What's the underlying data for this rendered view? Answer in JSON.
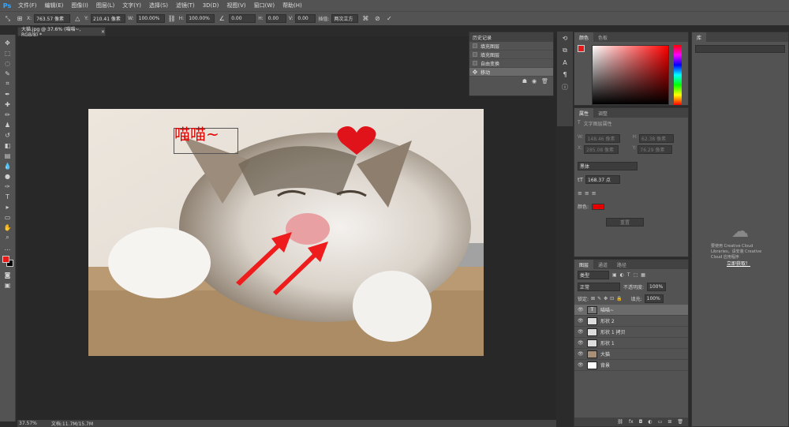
{
  "app": {
    "logo": "Ps"
  },
  "menu": [
    "文件(F)",
    "编辑(E)",
    "图像(I)",
    "图层(L)",
    "文字(Y)",
    "选择(S)",
    "滤镜(T)",
    "3D(D)",
    "视图(V)",
    "窗口(W)",
    "帮助(H)"
  ],
  "options": {
    "x_label": "X:",
    "x_value": "763.57 像素",
    "y_label": "Y:",
    "y_value": "210.41 像素",
    "w_label": "W:",
    "w_value": "100.00%",
    "h_label": "H:",
    "h_value": "100.00%",
    "angle_value": "0.00",
    "hskew_label": "H:",
    "hskew_value": "0.00",
    "vskew_label": "V:",
    "vskew_value": "0.00",
    "interp_label": "插值:",
    "interp_value": "两次立方"
  },
  "document": {
    "tab_title": "大猫.jpg @ 37.6% (喵喵~, RGB/8) *",
    "annotation_text": "喵喵~",
    "zoom": "37.57%",
    "doc_size": "文档:11.7M/15.7M"
  },
  "history": {
    "title": "历史记录",
    "items": [
      {
        "label": "填充图层",
        "selected": false
      },
      {
        "label": "填充图层",
        "selected": false
      },
      {
        "label": "自由变换",
        "selected": false
      },
      {
        "label": "移动",
        "selected": true
      }
    ]
  },
  "color_panel": {
    "tabs": [
      "颜色",
      "色板"
    ],
    "fg_color": "#e61919",
    "bg_color": "#000000"
  },
  "properties": {
    "tabs": [
      "属性",
      "调整"
    ],
    "subtitle": "文字图层属性",
    "w_label": "W:",
    "w_value": "148.46 像素",
    "h_label": "H:",
    "h_value": "62.38 像素",
    "x_label": "X:",
    "x_value": "285.08 像素",
    "y_label": "Y:",
    "y_value": "76.29 像素",
    "font_family": "黑体",
    "font_size": "168.37 点",
    "color_label": "颜色:",
    "color_value": "#e50000",
    "reset_label": "重置"
  },
  "layers_panel": {
    "tabs": [
      "图层",
      "通道",
      "路径"
    ],
    "filter_kind": "类型",
    "blend_mode": "正常",
    "opacity_label": "不透明度:",
    "opacity_value": "100%",
    "lock_label": "锁定:",
    "fill_label": "填充:",
    "fill_value": "100%",
    "layers": [
      {
        "name": "喵喵~",
        "type": "text",
        "selected": true
      },
      {
        "name": "形状 2",
        "type": "shape",
        "selected": false
      },
      {
        "name": "形状 1 拷贝",
        "type": "shape",
        "selected": false
      },
      {
        "name": "形状 1",
        "type": "shape",
        "selected": false
      },
      {
        "name": "大猫",
        "type": "image",
        "selected": false
      },
      {
        "name": "背景",
        "type": "bg",
        "selected": false
      }
    ]
  },
  "library": {
    "tab": "库",
    "message": "要使用 Creative Cloud Libraries，请安装 Creative Cloud 应用程序",
    "link": "立即获取！"
  }
}
